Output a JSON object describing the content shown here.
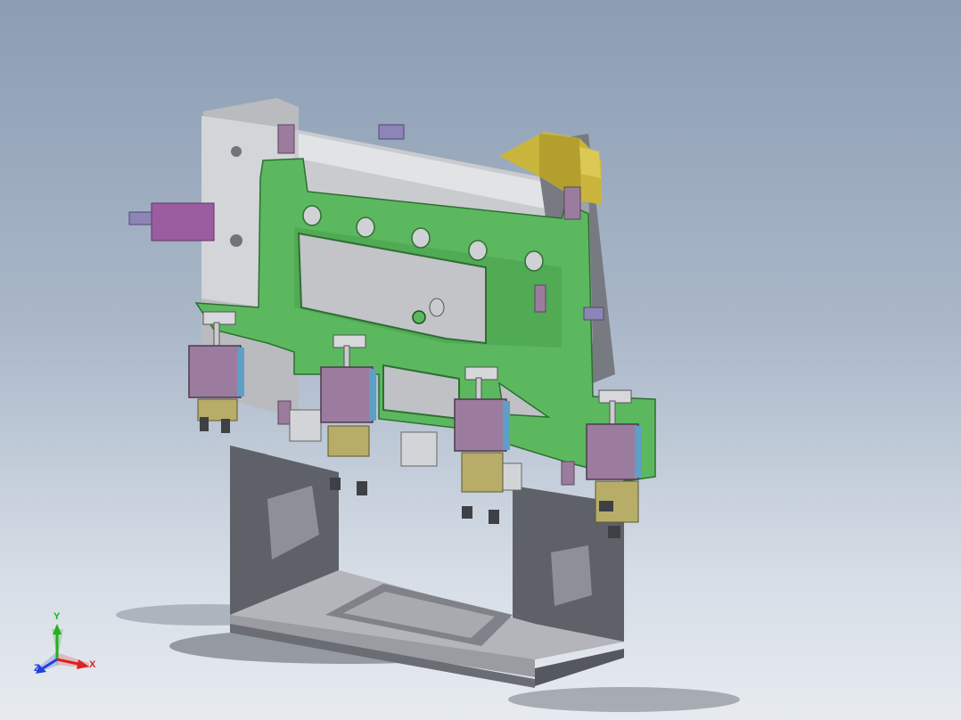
{
  "viewport": {
    "colors": {
      "background_top": "#8c9db3",
      "background_bottom": "#e7ebf0",
      "base_frame": "#5e6168",
      "base_frame_light": "#8a8d94",
      "plate_green": "#5cb85f",
      "plate_green_dark": "#3d8e42",
      "slide_grey": "#c9cbcf",
      "block_purple": "#9c7c9e",
      "block_blue": "#5d9fc6",
      "cylinder_yellow": "#c9b53c",
      "bracket_tan": "#b7ad68"
    }
  },
  "triad": {
    "x_label": "X",
    "y_label": "Y",
    "z_label": "Z",
    "x_color": "#e02020",
    "y_color": "#20b020",
    "z_color": "#2040e0"
  }
}
